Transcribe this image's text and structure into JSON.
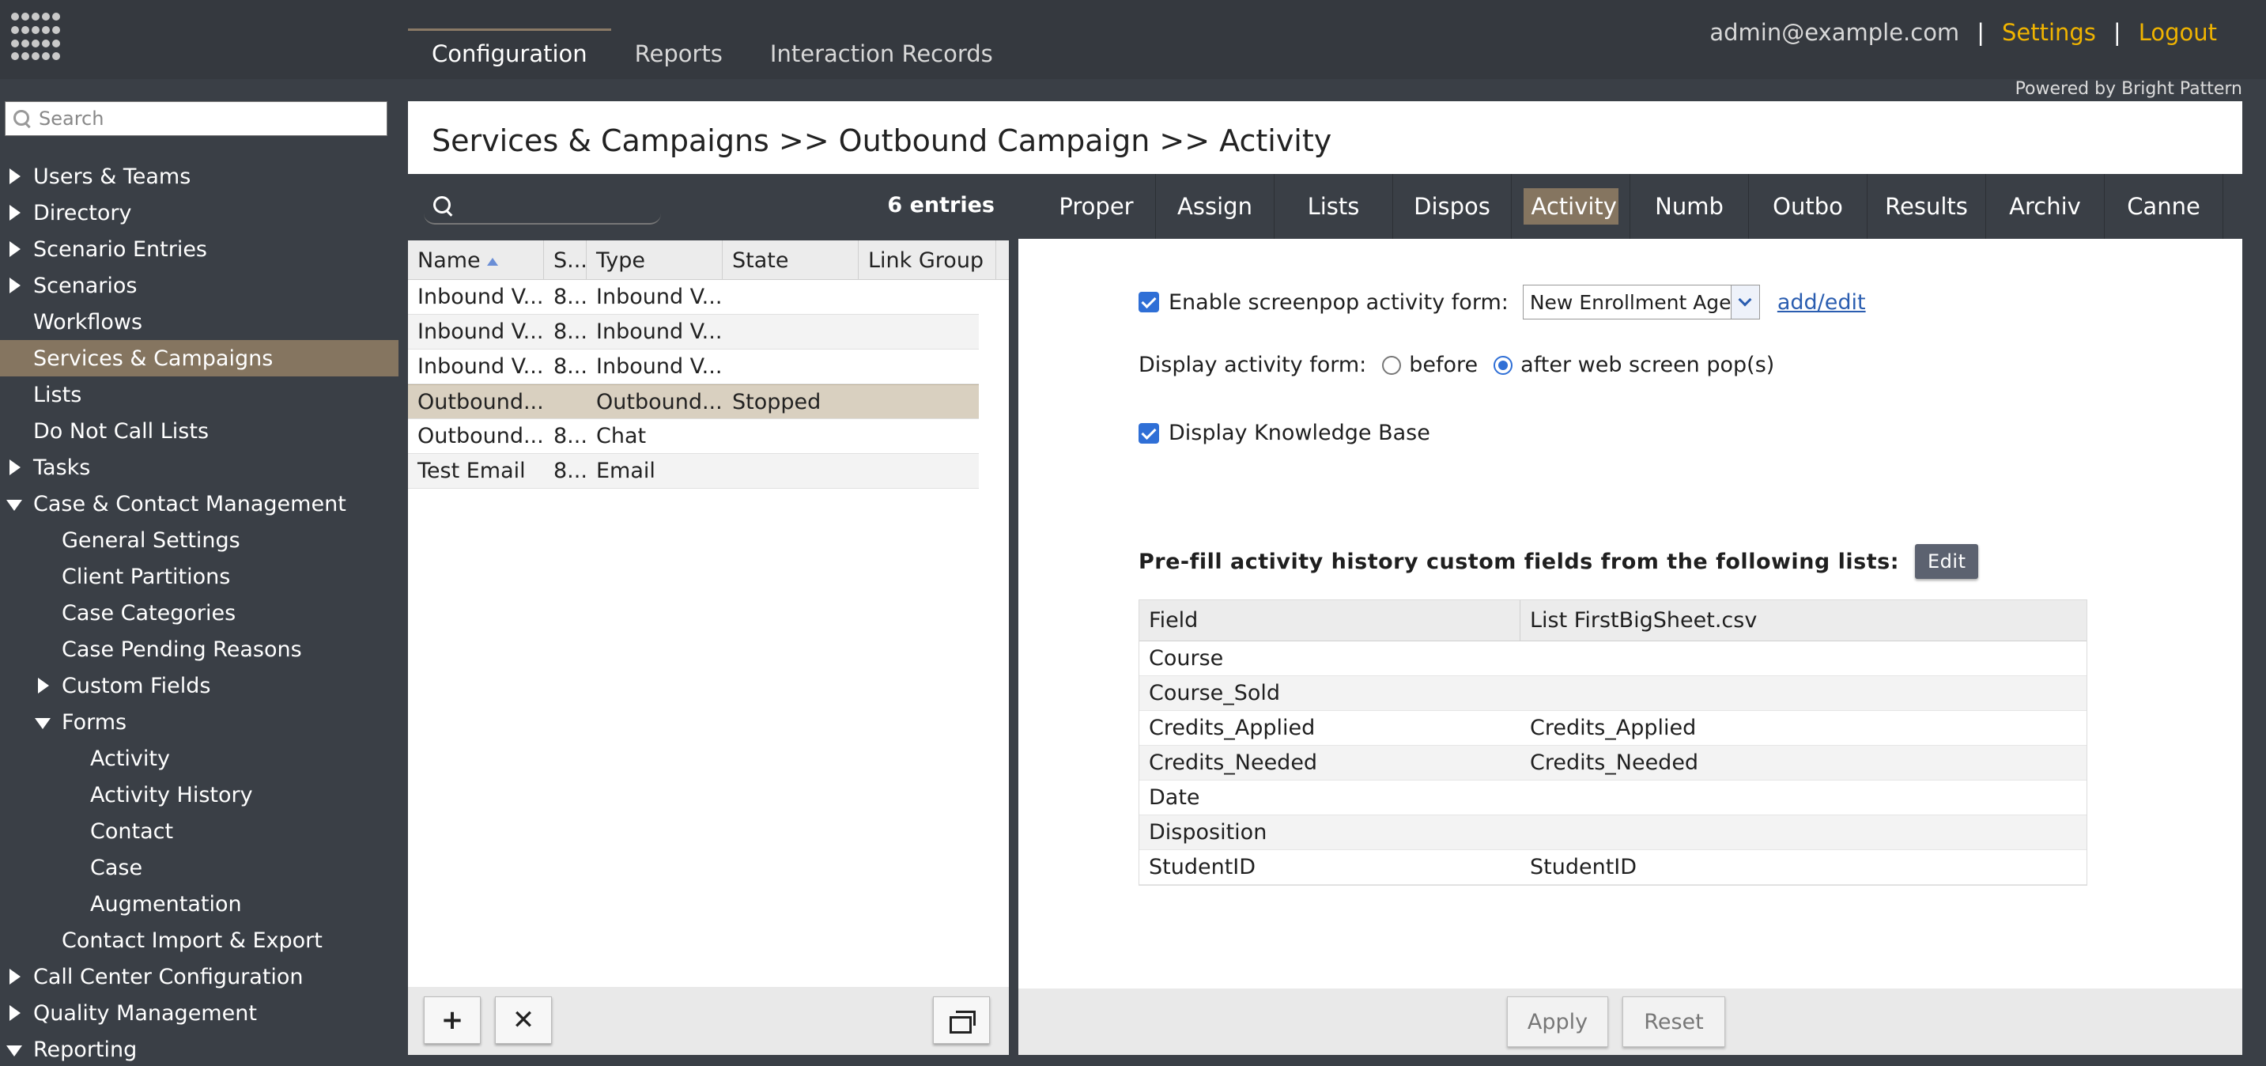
{
  "topbar": {
    "nav_tabs": [
      "Configuration",
      "Reports",
      "Interaction Records"
    ],
    "user_email": "admin@example.com",
    "separator": "|",
    "settings_label": "Settings",
    "logout_label": "Logout",
    "powered_by": "Powered by Bright Pattern",
    "accent_color": "#f0b400"
  },
  "sidebar": {
    "search_placeholder": "Search",
    "items": [
      {
        "label": "Users & Teams",
        "expander": "closed",
        "level": 0
      },
      {
        "label": "Directory",
        "expander": "closed",
        "level": 0
      },
      {
        "label": "Scenario Entries",
        "expander": "closed",
        "level": 0
      },
      {
        "label": "Scenarios",
        "expander": "closed",
        "level": 0
      },
      {
        "label": "Workflows",
        "expander": "none",
        "level": 0
      },
      {
        "label": "Services & Campaigns",
        "expander": "none",
        "level": 0,
        "selected": true
      },
      {
        "label": "Lists",
        "expander": "none",
        "level": 0
      },
      {
        "label": "Do Not Call Lists",
        "expander": "none",
        "level": 0
      },
      {
        "label": "Tasks",
        "expander": "closed",
        "level": 0
      },
      {
        "label": "Case & Contact Management",
        "expander": "open",
        "level": 0
      },
      {
        "label": "General Settings",
        "expander": "none",
        "level": 1
      },
      {
        "label": "Client Partitions",
        "expander": "none",
        "level": 1
      },
      {
        "label": "Case Categories",
        "expander": "none",
        "level": 1
      },
      {
        "label": "Case Pending Reasons",
        "expander": "none",
        "level": 1
      },
      {
        "label": "Custom Fields",
        "expander": "closed",
        "level": 1
      },
      {
        "label": "Forms",
        "expander": "open",
        "level": 1
      },
      {
        "label": "Activity",
        "expander": "none",
        "level": 2
      },
      {
        "label": "Activity History",
        "expander": "none",
        "level": 2
      },
      {
        "label": "Contact",
        "expander": "none",
        "level": 2
      },
      {
        "label": "Case",
        "expander": "none",
        "level": 2
      },
      {
        "label": "Augmentation",
        "expander": "none",
        "level": 2
      },
      {
        "label": "Contact Import & Export",
        "expander": "none",
        "level": 1
      },
      {
        "label": "Call Center Configuration",
        "expander": "closed",
        "level": 0
      },
      {
        "label": "Quality Management",
        "expander": "closed",
        "level": 0
      },
      {
        "label": "Reporting",
        "expander": "open",
        "level": 0
      }
    ]
  },
  "breadcrumb": "Services & Campaigns >> Outbound Campaign >> Activity",
  "list": {
    "entries_label": "6 entries",
    "columns": [
      "Name",
      "S...",
      "Type",
      "State",
      "Link Group"
    ],
    "rows": [
      [
        "Inbound V...",
        "8...",
        "Inbound V...",
        "",
        ""
      ],
      [
        "Inbound V...",
        "8...",
        "Inbound V...",
        "",
        ""
      ],
      [
        "Inbound V...",
        "8...",
        "Inbound V...",
        "",
        ""
      ],
      [
        "Outbound...",
        "",
        "Outbound...",
        "Stopped",
        ""
      ],
      [
        "Outbound...",
        "8...",
        "Chat",
        "",
        ""
      ],
      [
        "Test Email",
        "8...",
        "Email",
        "",
        ""
      ]
    ],
    "selected_row": 3,
    "add_label": "+",
    "delete_label": "✕"
  },
  "detail": {
    "tabs": [
      "Proper",
      "Assign",
      "Lists",
      "Dispos",
      "Activity",
      "Numb",
      "Outbo",
      "Results",
      "Archiv",
      "Canne"
    ],
    "active_tab": 4,
    "enable_screenpop_label": "Enable screenpop activity form:",
    "form_select_value": "New Enrollment Agent",
    "add_edit_label": "add/edit",
    "display_form_label": "Display activity form:",
    "radio_before": "before",
    "radio_after": "after web screen pop(s)",
    "display_kb_label": "Display Knowledge Base",
    "prefill_label": "Pre-fill activity history custom fields from the following lists:",
    "edit_label": "Edit",
    "table_headers": [
      "Field",
      "List FirstBigSheet.csv"
    ],
    "table_rows": [
      [
        "Course",
        ""
      ],
      [
        "Course_Sold",
        ""
      ],
      [
        "Credits_Applied",
        "Credits_Applied"
      ],
      [
        "Credits_Needed",
        "Credits_Needed"
      ],
      [
        "Date",
        ""
      ],
      [
        "Disposition",
        ""
      ],
      [
        "StudentID",
        "StudentID"
      ]
    ],
    "apply_label": "Apply",
    "reset_label": "Reset"
  }
}
